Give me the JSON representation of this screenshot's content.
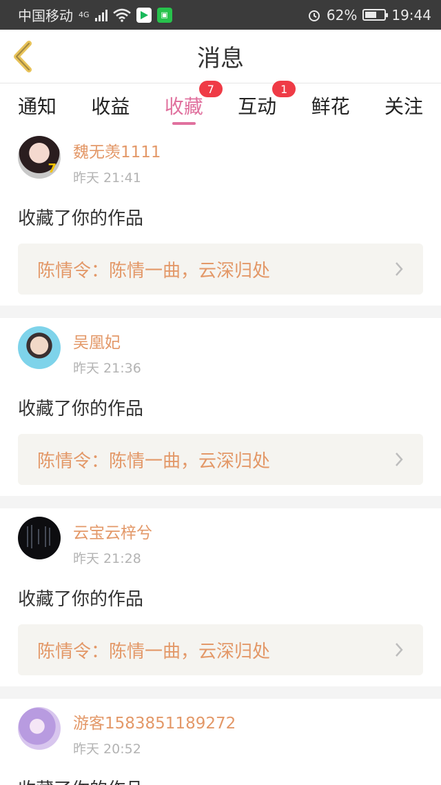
{
  "status_bar": {
    "carrier": "中国移动",
    "network": "4G",
    "battery": "62%",
    "battery_level": 0.62,
    "time": "19:44"
  },
  "header": {
    "title": "消息"
  },
  "tabs": [
    {
      "label": "通知",
      "badge": null,
      "active": false
    },
    {
      "label": "收益",
      "badge": null,
      "active": false
    },
    {
      "label": "收藏",
      "badge": "7",
      "active": true
    },
    {
      "label": "互动",
      "badge": "1",
      "active": false
    },
    {
      "label": "鲜花",
      "badge": null,
      "active": false
    },
    {
      "label": "关注",
      "badge": null,
      "active": false
    }
  ],
  "feed": [
    {
      "name": "魏无羡1111",
      "time": "昨天 21:41",
      "action": "收藏了你的作品",
      "work": "陈情令：陈情一曲，云深归处",
      "avatar": "avatar-photo-girl"
    },
    {
      "name": "吴凰妃",
      "time": "昨天 21:36",
      "action": "收藏了你的作品",
      "work": "陈情令：陈情一曲，云深归处",
      "avatar": "avatar-photo-boy"
    },
    {
      "name": "云宝云梓兮",
      "time": "昨天 21:28",
      "action": "收藏了你的作品",
      "work": "陈情令：陈情一曲，云深归处",
      "avatar": "avatar-dark-text"
    },
    {
      "name": "游客1583851189272",
      "time": "昨天 20:52",
      "action": "收藏了你的作品",
      "work": "陈情令：陈情一曲，云深归处",
      "avatar": "avatar-purple-anime"
    }
  ],
  "colors": {
    "accent": "#e0719e",
    "name": "#e39868",
    "badge": "#ef3b46",
    "status_bar": "#3b3b3b"
  }
}
